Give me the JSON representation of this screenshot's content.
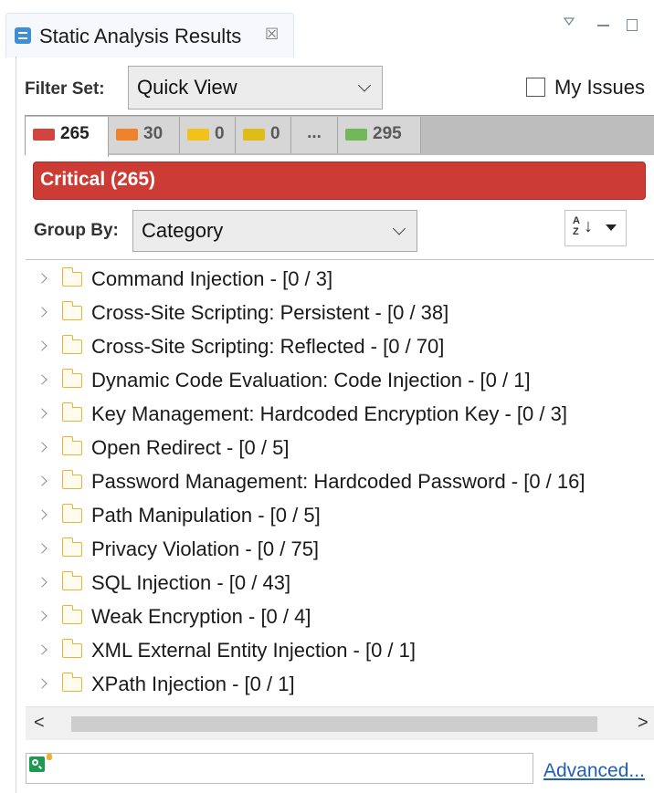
{
  "view": {
    "title": "Static Analysis Results",
    "close_symbol": "☒",
    "icons": [
      "static-analysis-view-icon",
      "view-menu-icon",
      "minimize-icon",
      "maximize-icon"
    ]
  },
  "filter": {
    "label": "Filter Set:",
    "selected": "Quick View",
    "my_issues_label": "My Issues",
    "my_issues_checked": false
  },
  "severity_tabs": [
    {
      "count": "265",
      "color": "#d4443f",
      "active": true
    },
    {
      "count": "30",
      "color": "#f0822a",
      "active": false
    },
    {
      "count": "0",
      "color": "#f2c21a",
      "active": false
    },
    {
      "count": "0",
      "color": "#e0bc18",
      "active": false
    },
    {
      "count": "...",
      "color": "",
      "active": false
    },
    {
      "count": "295",
      "color": "#74b75a",
      "active": false
    }
  ],
  "severity_header": {
    "text": "Critical (265)",
    "color": "#cc3b34"
  },
  "group_by": {
    "label": "Group By:",
    "selected": "Category"
  },
  "tree_items": [
    "Command Injection - [0 / 3]",
    "Cross-Site Scripting: Persistent - [0 / 38]",
    "Cross-Site Scripting: Reflected - [0 / 70]",
    "Dynamic Code Evaluation: Code Injection - [0 / 1]",
    "Key Management: Hardcoded Encryption Key - [0 / 3]",
    "Open Redirect - [0 / 5]",
    "Password Management: Hardcoded Password - [0 / 16]",
    "Path Manipulation - [0 / 5]",
    "Privacy Violation - [0 / 75]",
    "SQL Injection - [0 / 43]",
    "Weak Encryption - [0 / 4]",
    "XML External Entity Injection - [0 / 1]",
    "XPath Injection - [0 / 1]"
  ],
  "scroll": {
    "left_symbol": "<",
    "right_symbol": ">"
  },
  "search": {
    "value": "",
    "placeholder": ""
  },
  "advanced_label": "Advanced..."
}
